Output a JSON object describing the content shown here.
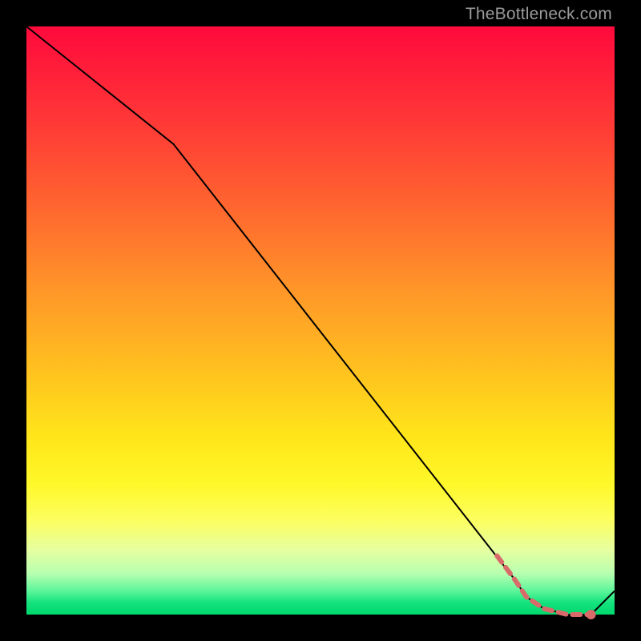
{
  "watermark": "TheBottleneck.com",
  "colors": {
    "line": "#000000",
    "dash": "#d96a6a",
    "dot": "#d96a6a"
  },
  "chart_data": {
    "type": "line",
    "title": "",
    "xlabel": "",
    "ylabel": "",
    "xlim": [
      0,
      100
    ],
    "ylim": [
      0,
      100
    ],
    "grid": false,
    "series": [
      {
        "name": "curve",
        "style": "solid",
        "color": "#000000",
        "x": [
          0,
          25,
          83,
          85,
          88,
          92,
          96,
          100
        ],
        "values": [
          100,
          80,
          6,
          3,
          1,
          0,
          0,
          4
        ]
      },
      {
        "name": "highlight-dash",
        "style": "dashed",
        "color": "#d96a6a",
        "x": [
          80,
          83,
          85,
          88,
          92,
          96
        ],
        "values": [
          10,
          6,
          3,
          1,
          0,
          0
        ]
      }
    ],
    "points": [
      {
        "name": "marker",
        "x": 96,
        "y": 0,
        "color": "#d96a6a"
      }
    ]
  }
}
